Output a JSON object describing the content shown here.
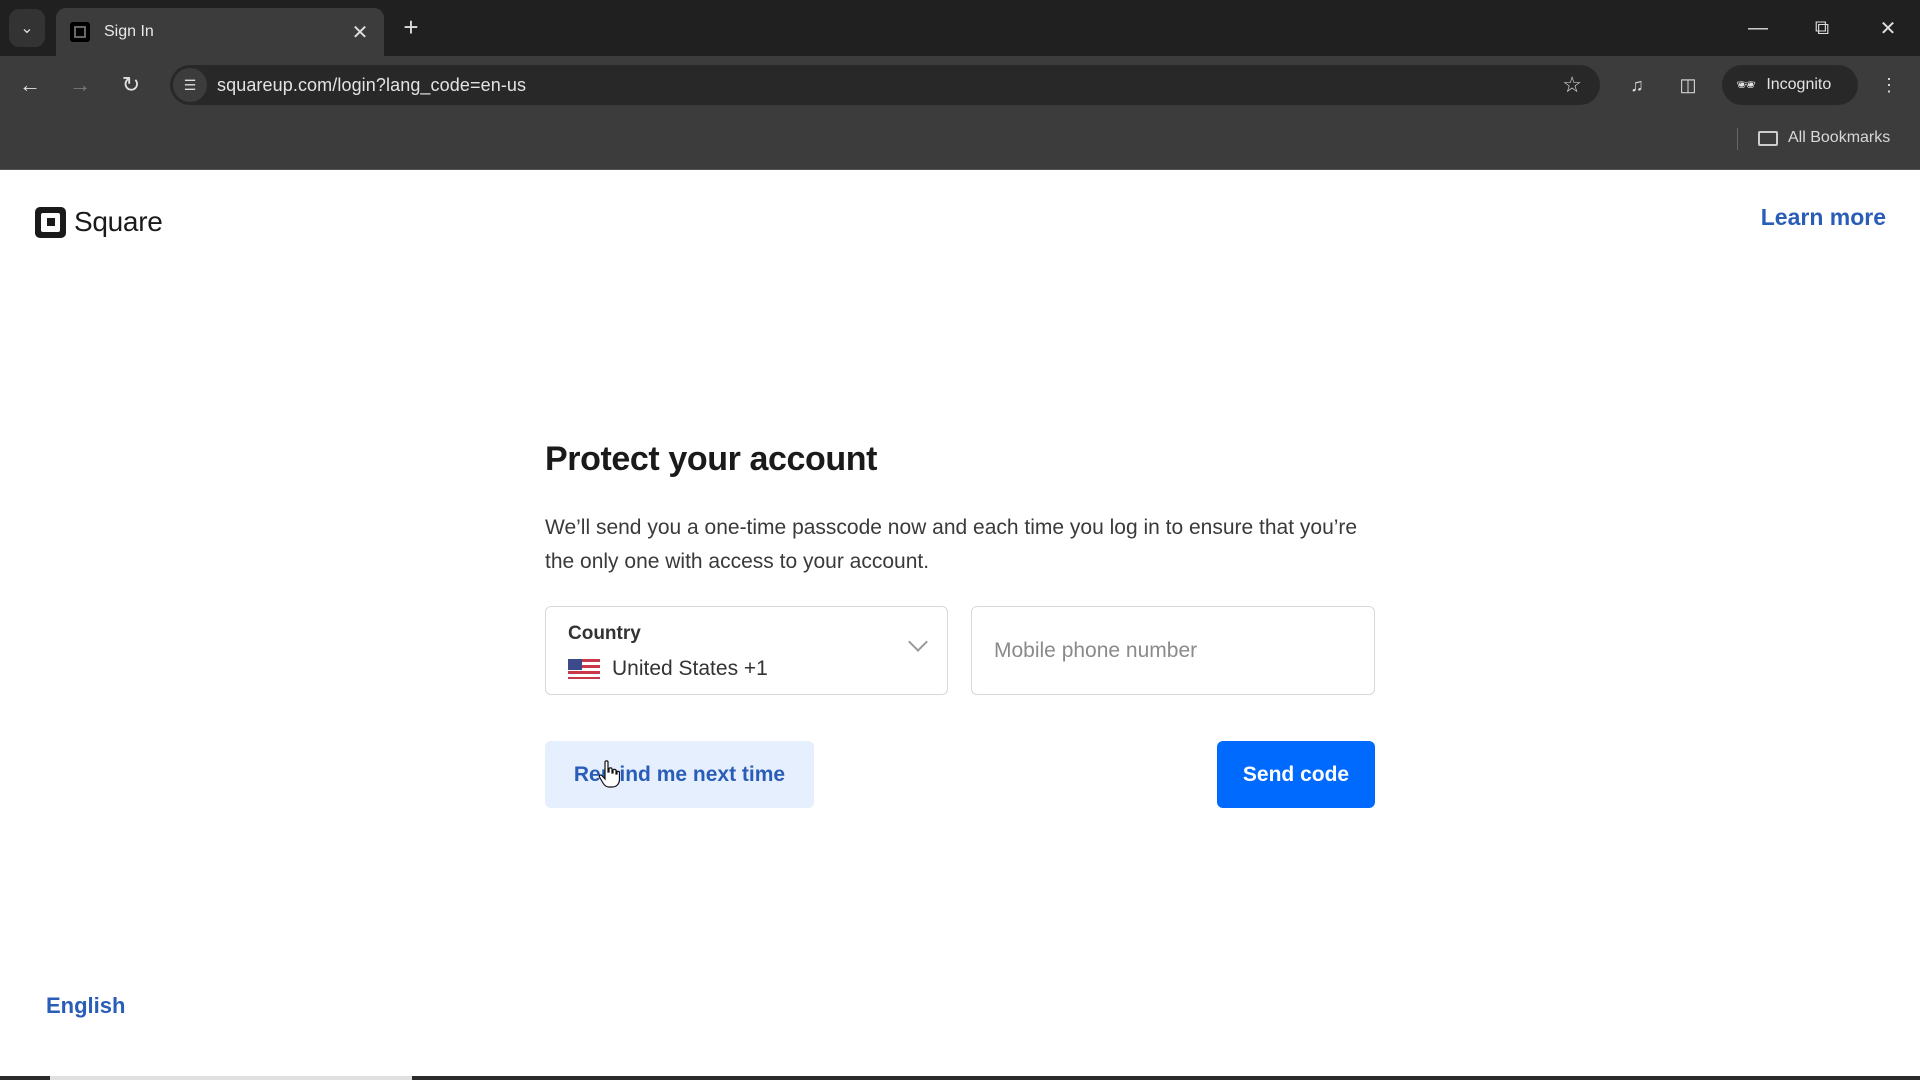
{
  "browser": {
    "tab_title": "Sign In",
    "url": "squareup.com/login?lang_code=en-us",
    "incognito_label": "Incognito",
    "all_bookmarks_label": "All Bookmarks",
    "icons": {
      "tab_search": "chevron-down-icon",
      "tab_close": "close-icon",
      "new_tab": "plus-icon",
      "back": "arrow-left-icon",
      "forward": "arrow-right-icon",
      "reload": "reload-icon",
      "site_info": "tune-icon",
      "bookmark": "star-icon",
      "media": "media-control-icon",
      "side_panel": "side-panel-icon",
      "menu": "kebab-menu-icon"
    }
  },
  "header": {
    "brand": "Square",
    "learn_more": "Learn more"
  },
  "main": {
    "heading": "Protect your account",
    "description": "We’ll send you a one-time passcode now and each time you log in to ensure that you’re the only one with access to your account.",
    "country_field": {
      "label": "Country",
      "value": "United States +1",
      "flag": "us-flag-icon"
    },
    "phone_field": {
      "value": "",
      "placeholder": "Mobile phone number"
    },
    "remind_button": "Remind me next time",
    "send_button": "Send code"
  },
  "footer": {
    "language": "English"
  },
  "colors": {
    "primary": "#006aff",
    "link": "#2a5db8",
    "secondary_button_bg": "#e6effd"
  }
}
